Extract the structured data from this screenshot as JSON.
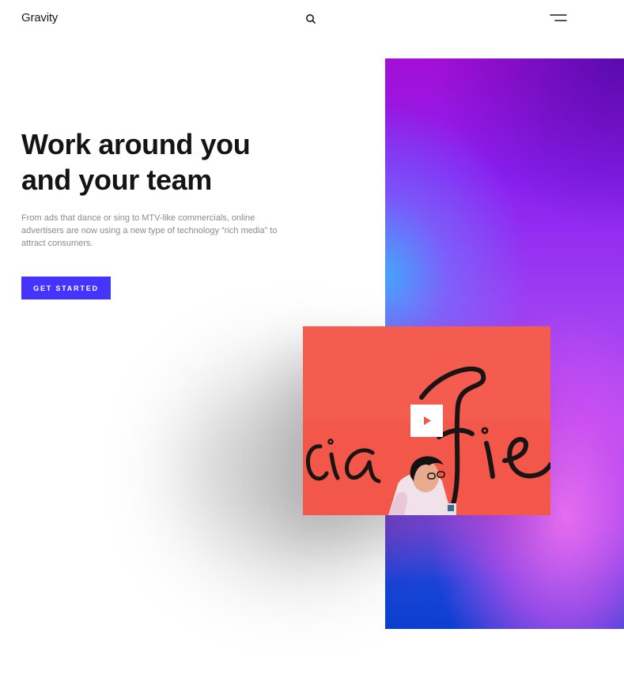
{
  "header": {
    "logo": "Gravity",
    "search_icon": "search-icon",
    "menu_icon": "hamburger-menu-icon"
  },
  "hero": {
    "title": "Work around you and your team",
    "subtitle": "From ads that dance or sing to MTV-like commercials, online advertisers are now using a new type of technology “rich media” to attract consumers.",
    "cta_label": "GET STARTED"
  },
  "media": {
    "play_icon": "play-icon",
    "mural_text": "cia fie"
  },
  "colors": {
    "accent": "#4534ff",
    "title": "#141414",
    "body_text": "#8b8b8b",
    "video_background": "#f2574a",
    "gradient_top": "#a40fd6",
    "gradient_bottom": "#0b3fcf"
  }
}
